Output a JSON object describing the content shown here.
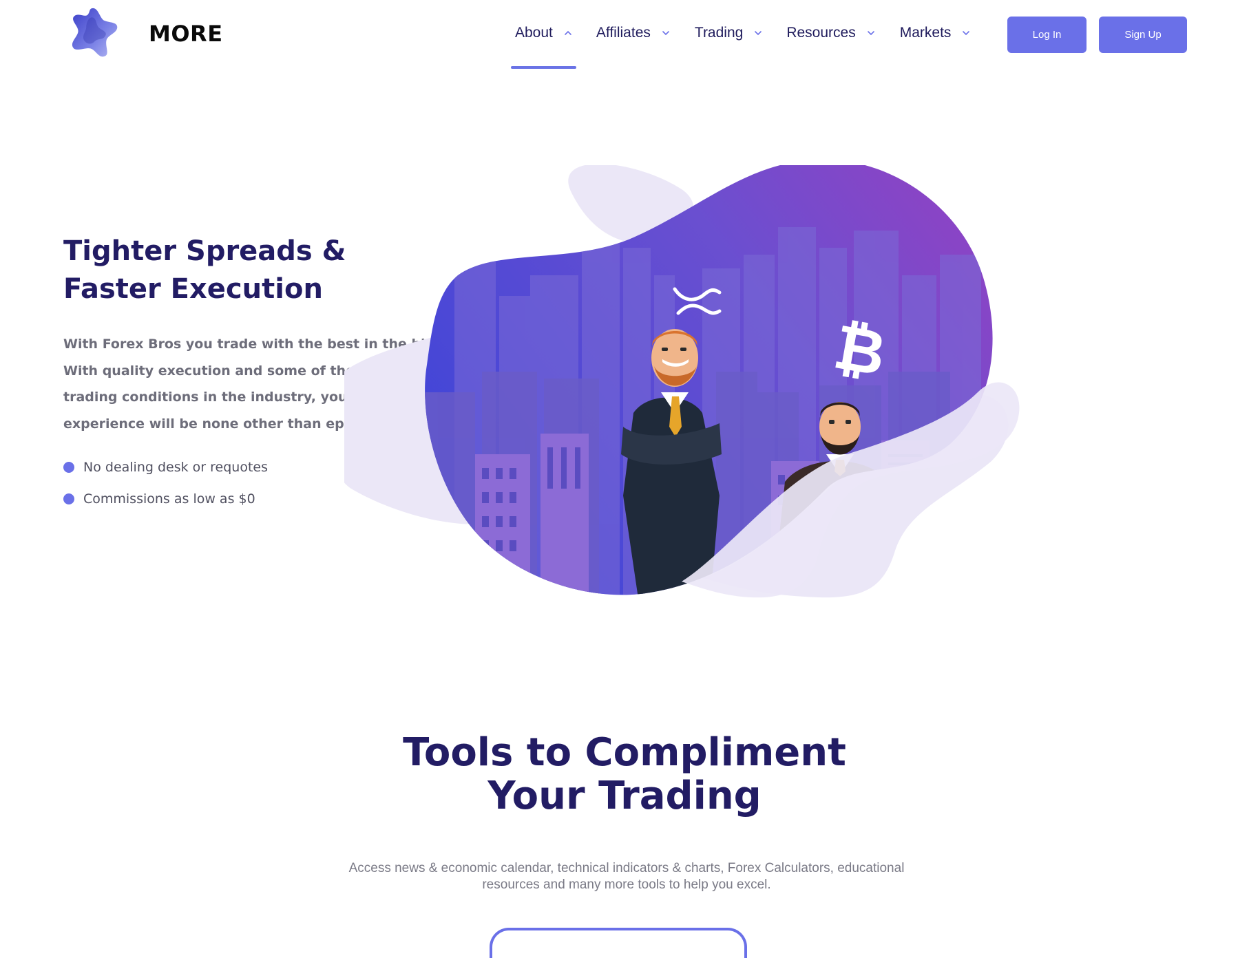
{
  "brand": {
    "name": "MORE",
    "logo_icon": "star-blob-logo"
  },
  "nav": {
    "items": [
      {
        "label": "About",
        "icon": "chevron-up-icon",
        "active": true
      },
      {
        "label": "Affiliates",
        "icon": "chevron-down-icon",
        "active": false
      },
      {
        "label": "Trading",
        "icon": "chevron-down-icon",
        "active": false
      },
      {
        "label": "Resources",
        "icon": "chevron-down-icon",
        "active": false
      },
      {
        "label": "Markets",
        "icon": "chevron-down-icon",
        "active": false
      }
    ],
    "login_label": "Log In",
    "signup_label": "Sign Up"
  },
  "hero": {
    "title": "Tighter Spreads & Faster Execution",
    "text": "With Forex Bros you trade with the best in the biz! With quality execution and some of the best trading conditions in the industry, your trading experience will be none other than epic.",
    "bullets": [
      "No dealing desk or requotes",
      "Commissions as low as $0"
    ],
    "illustration": "traders-city-bitcoin-illustration"
  },
  "tools": {
    "title_line1": "Tools to Compliment",
    "title_line2": "Your Trading",
    "text": "Access news & economic calendar, technical indicators & charts, Forex Calculators, educational resources and many more tools to help you excel."
  },
  "colors": {
    "accent": "#6a70e8",
    "heading": "#221c64",
    "body_text": "#6d6d7a",
    "blob_light": "#ebe7f7",
    "blob_gradient_start": "#4a4ed6",
    "blob_gradient_end": "#8a3fc4"
  }
}
